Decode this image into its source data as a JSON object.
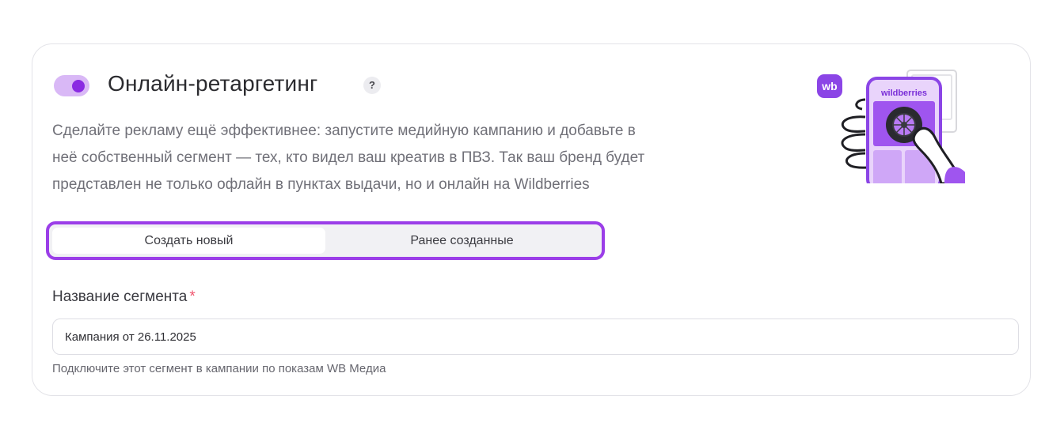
{
  "section": {
    "title": "Онлайн-ретаргетинг",
    "help_symbol": "?",
    "toggle_on": true,
    "description_lines": [
      "Сделайте рекламу ещё эффективнее: запустите медийную кампанию и добавьте в",
      "неё собственный сегмент — тех, кто видел ваш креатив в ПВЗ. Так ваш бренд будет",
      "представлен не только офлайн в пунктах выдачи, но и онлайн на Wildberries"
    ]
  },
  "illustration": {
    "badge_text": "wb",
    "phone_brand": "wildberries"
  },
  "tabs": [
    {
      "label": "Создать новый",
      "active": true
    },
    {
      "label": "Ранее созданные",
      "active": false
    }
  ],
  "segment_field": {
    "label": "Название сегмента",
    "required_mark": "*",
    "value": "Кампания от 26.11.2025",
    "hint": "Подключите этот сегмент в кампании по показам WB Медиа"
  },
  "colors": {
    "accent": "#9b3ee8",
    "toggle_track": "#d9b8f6",
    "toggle_knob": "#8a2be2",
    "required": "#f0566f"
  }
}
